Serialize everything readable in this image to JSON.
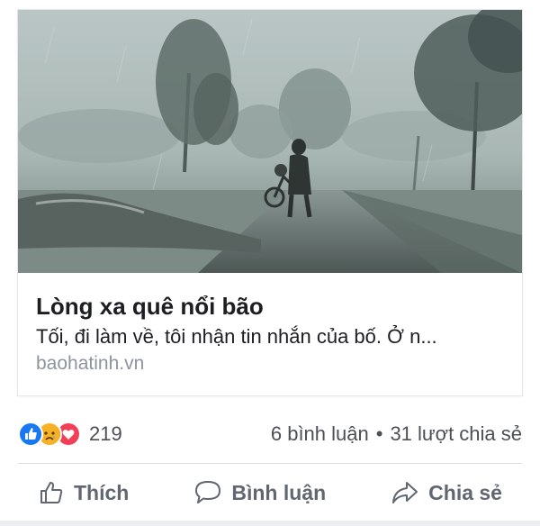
{
  "post": {
    "link_preview": {
      "title": "Lòng xa quê nổi bão",
      "description": "Tối, đi làm về, tôi nhận tin nhắn của bố. Ở n...",
      "domain": "baohatinh.vn"
    },
    "reactions": {
      "types": [
        "like",
        "sad",
        "love"
      ],
      "count": "219"
    },
    "comments_label": "6 bình luận",
    "separator": "•",
    "shares_label": "31 lượt chia sẻ"
  },
  "actions": {
    "like_label": "Thích",
    "comment_label": "Bình luận",
    "share_label": "Chia sẻ"
  },
  "colors": {
    "like_blue": "#1877f2",
    "love_red": "#f33e58",
    "sad_yellow": "#f7b125",
    "text_primary": "#1c1e21",
    "text_secondary": "#606770",
    "domain_gray": "#8d949e"
  }
}
